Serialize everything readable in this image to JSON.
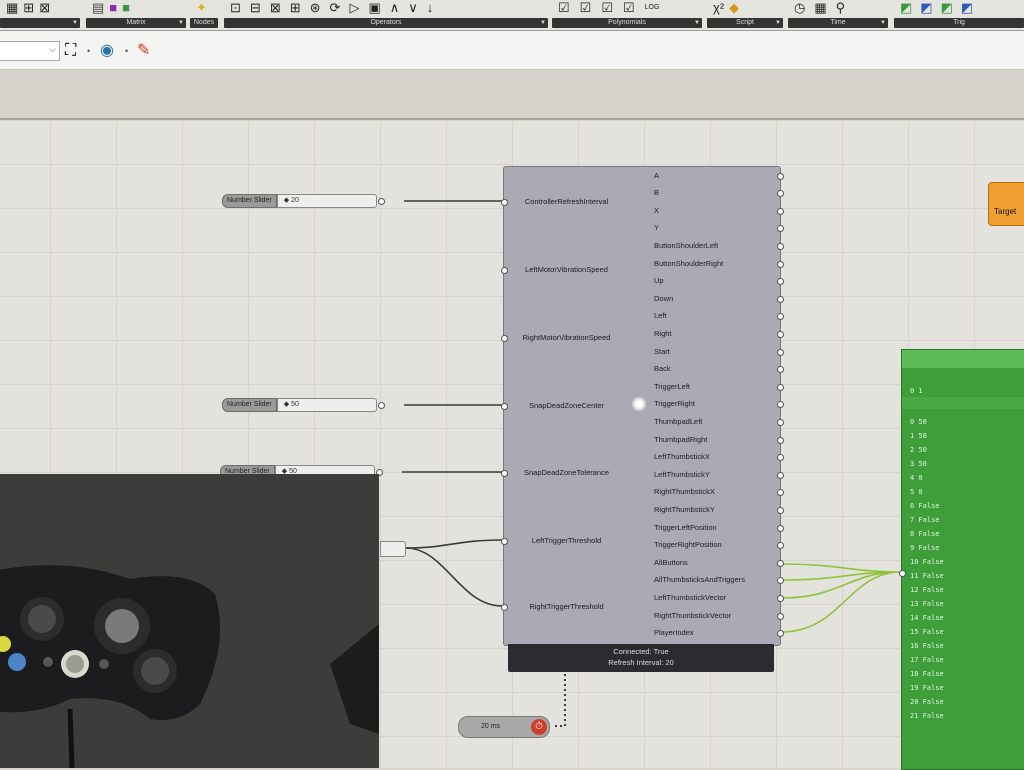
{
  "ribbon": {
    "groups": [
      {
        "label": "",
        "icons": [
          "grid-icon",
          "matrix-icon",
          "graph-icon"
        ]
      },
      {
        "label": "Matrix",
        "icons": [
          "table-icon",
          "matrix-color-icon",
          "transpose-icon"
        ]
      },
      {
        "label": "Nodes",
        "icons": [
          "lightbulb-icon"
        ]
      },
      {
        "label": "Operators",
        "icons": [
          "op-1-icon",
          "op-2-icon",
          "op-3-icon",
          "op-4-icon",
          "op-5-icon",
          "op-6-icon",
          "op-7-icon",
          "op-8-icon",
          "op-9-icon",
          "op-10-icon",
          "op-11-icon"
        ]
      },
      {
        "label": "Polynomials",
        "icons": [
          "poly-1-icon",
          "poly-2-icon",
          "poly-3-icon",
          "poly-4-icon",
          "log-icon"
        ]
      },
      {
        "label": "Script",
        "icons": [
          "script-icon",
          "python-icon"
        ]
      },
      {
        "label": "Time",
        "icons": [
          "clock-icon",
          "date-icon",
          "interval-icon"
        ]
      },
      {
        "label": "Trig",
        "icons": [
          "trig-1-icon",
          "trig-2-icon",
          "trig-3-icon",
          "trig-4-icon"
        ]
      }
    ],
    "log_text": "LOG"
  },
  "canvas": {
    "sliders": [
      {
        "name": "Number Slider",
        "value": "20"
      },
      {
        "name": "Number Slider",
        "value": "50"
      },
      {
        "name": "Number Slider",
        "value": "50"
      }
    ],
    "component": {
      "inputs": [
        "ControllerRefreshInterval",
        "LeftMotorVibrationSpeed",
        "RightMotorVibrationSpeed",
        "SnapDeadZoneCenter",
        "SnapDeadZoneTolerance",
        "LeftTriggerThreshold",
        "RightTriggerThreshold"
      ],
      "outputs": [
        "A",
        "B",
        "X",
        "Y",
        "ButtonShoulderLeft",
        "ButtonShoulderRight",
        "Up",
        "Down",
        "Left",
        "Right",
        "Start",
        "Back",
        "TriggerLeft",
        "TriggerRight",
        "ThumbpadLeft",
        "ThumbpadRight",
        "LeftThumbstickX",
        "LeftThumbstickY",
        "RightThumbstickX",
        "RightThumbstickY",
        "TriggerLeftPosition",
        "TriggerRightPosition",
        "AllButtons",
        "AllThumbsticksAndTriggers",
        "LeftThumbstickVector",
        "RightThumbstickVector",
        "PlayerIndex"
      ],
      "status_line1": "Connected: True",
      "status_line2": "Refresh Interval: 20"
    },
    "timer": {
      "value": "20 ms"
    },
    "orange_component": {
      "label": "Target"
    },
    "panel": {
      "rows": [
        "0 1",
        "",
        "0 50",
        "1 50",
        "2 50",
        "3 50",
        "4 0",
        "5 0",
        "6 False",
        "7 False",
        "8 False",
        "9 False",
        "10 False",
        "11 False",
        "12 False",
        "13 False",
        "14 False",
        "15 False",
        "16 False",
        "17 False",
        "18 False",
        "19 False",
        "20 False",
        "21 False"
      ]
    }
  },
  "colors": {
    "component": "#a9aab4",
    "panel": "#3e9f3a",
    "orange": "#f0a033",
    "wire": "#3a3a3a",
    "wire_green": "#8fc43a"
  }
}
